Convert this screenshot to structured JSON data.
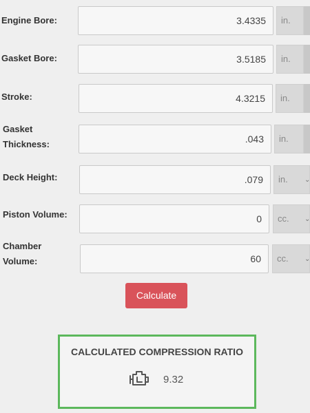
{
  "fields": [
    {
      "label": "Engine Bore:",
      "value": "3.4335",
      "unit": "in."
    },
    {
      "label": "Gasket Bore:",
      "value": "3.5185",
      "unit": "in."
    },
    {
      "label": "Stroke:",
      "value": "4.3215",
      "unit": "in."
    },
    {
      "label": "Gasket\nThickness:",
      "value": ".043",
      "unit": "in."
    },
    {
      "label": "Deck Height:",
      "value": ".079",
      "unit": "in."
    },
    {
      "label": "Piston Volume:",
      "value": "0",
      "unit": "cc."
    },
    {
      "label": "Chamber\nVolume:",
      "value": "60",
      "unit": "cc."
    }
  ],
  "calculate_label": "Calculate",
  "result": {
    "title": "CALCULATED COMPRESSION RATIO",
    "value": "9.32",
    "icon": "engine-icon"
  },
  "colors": {
    "button": "#d9535a",
    "result_border": "#5cb85c"
  }
}
